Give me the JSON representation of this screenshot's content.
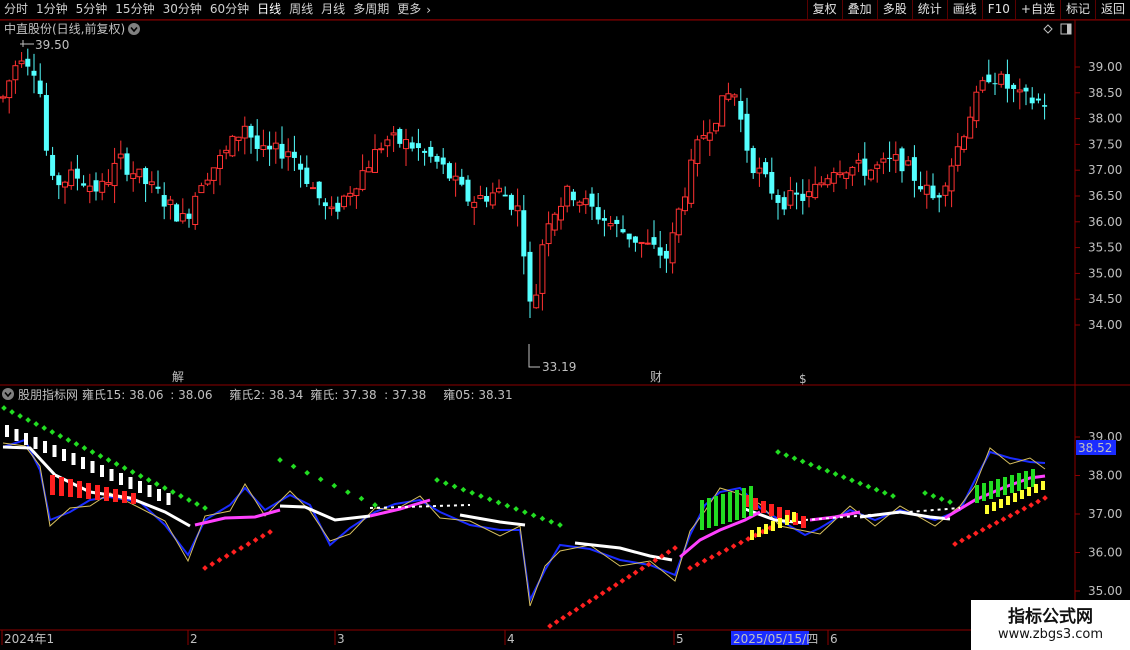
{
  "toolbar": {
    "periods": [
      "分时",
      "1分钟",
      "5分钟",
      "15分钟",
      "30分钟",
      "60分钟",
      "日线",
      "周线",
      "月线",
      "多周期",
      "更多"
    ],
    "active_period": "日线",
    "more_icon": "chevron-right-icon",
    "buttons": [
      "复权",
      "叠加",
      "多股",
      "统计",
      "画线",
      "F10",
      "+自选",
      "标记",
      "返回"
    ]
  },
  "main_panel": {
    "title": "中直股份(日线,前复权)",
    "dropdown_icon": "chevron-down-icon",
    "high_label": "39.50",
    "low_label": "33.19",
    "price_ticks": [
      "39.00",
      "38.50",
      "38.00",
      "37.50",
      "37.00",
      "36.50",
      "36.00",
      "35.50",
      "35.00",
      "34.50",
      "34.00"
    ],
    "markers": [
      "解",
      "财",
      "$"
    ],
    "corner_icons": [
      "diamond-icon",
      "panel-toggle-icon"
    ]
  },
  "indicator_panel": {
    "name": "股朋指标网",
    "dropdown_icon": "chevron-down-icon",
    "legend": [
      {
        "label": "雍氏15: 38.06",
        "color": "#3060ff"
      },
      {
        "label": ": 38.06",
        "color": "#ff40ff"
      },
      {
        "label": "雍氏2: 38.34",
        "color": "#3060ff"
      },
      {
        "label": "雍氏: 37.38",
        "color": "#e0e0e0"
      },
      {
        "label": ": 37.38",
        "color": "#ff3030"
      },
      {
        "label": "雍05: 38.31",
        "color": "#e0c040"
      }
    ],
    "ticks": [
      "39.00",
      "38.00",
      "37.00",
      "36.00",
      "35.00"
    ],
    "current_value": "38.52"
  },
  "date_axis": {
    "labels": [
      "2024年1",
      "2",
      "3",
      "4",
      "5",
      "6"
    ],
    "highlight_date": "2025/05/15/四"
  },
  "watermark": {
    "line1": "指标公式网",
    "line2": "www.zbgs3.com"
  },
  "colors": {
    "up": "#ff3232",
    "down": "#54ffff",
    "grid": "#8b0000",
    "blue": "#1a2cff",
    "magenta": "#ff40ff",
    "white": "#ffffff",
    "green": "#22dd22",
    "yellow": "#ffff30"
  }
}
